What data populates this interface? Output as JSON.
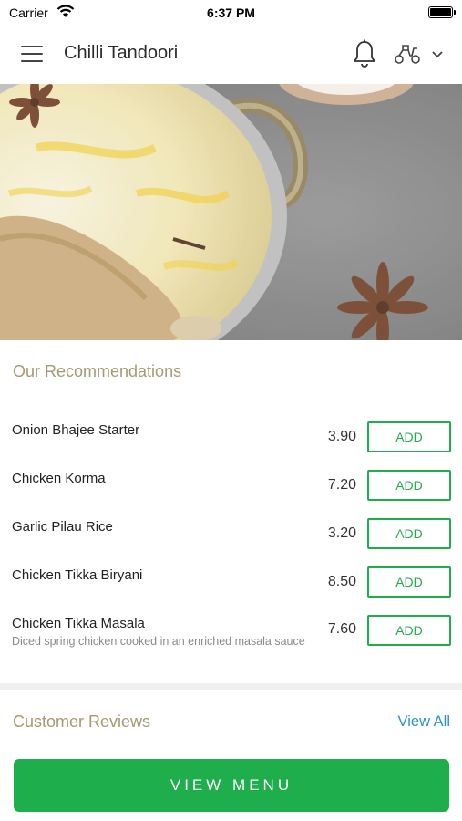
{
  "status_bar": {
    "carrier": "Carrier",
    "time": "6:37 PM"
  },
  "header": {
    "title": "Chilli Tandoori",
    "icons": [
      "menu-icon",
      "bell-icon",
      "scooter-icon",
      "chevron-down-icon"
    ]
  },
  "recommendations": {
    "title": "Our Recommendations",
    "items": [
      {
        "name": "Onion Bhajee Starter",
        "description": "",
        "price": "3.90",
        "button": "ADD"
      },
      {
        "name": "Chicken Korma",
        "description": "",
        "price": "7.20",
        "button": "ADD"
      },
      {
        "name": "Garlic Pilau Rice",
        "description": "",
        "price": "3.20",
        "button": "ADD"
      },
      {
        "name": "Chicken Tikka Biryani",
        "description": "",
        "price": "8.50",
        "button": "ADD"
      },
      {
        "name": "Chicken Tikka Masala",
        "description": "Diced spring chicken cooked in an enriched masala sauce",
        "price": "7.60",
        "button": "ADD"
      }
    ]
  },
  "reviews": {
    "title": "Customer Reviews",
    "view_all": "View All"
  },
  "footer": {
    "view_menu": "VIEW MENU"
  },
  "colors": {
    "accent_green": "#1fae4c",
    "section_title": "#a59a70",
    "link_blue": "#2b93c9"
  }
}
